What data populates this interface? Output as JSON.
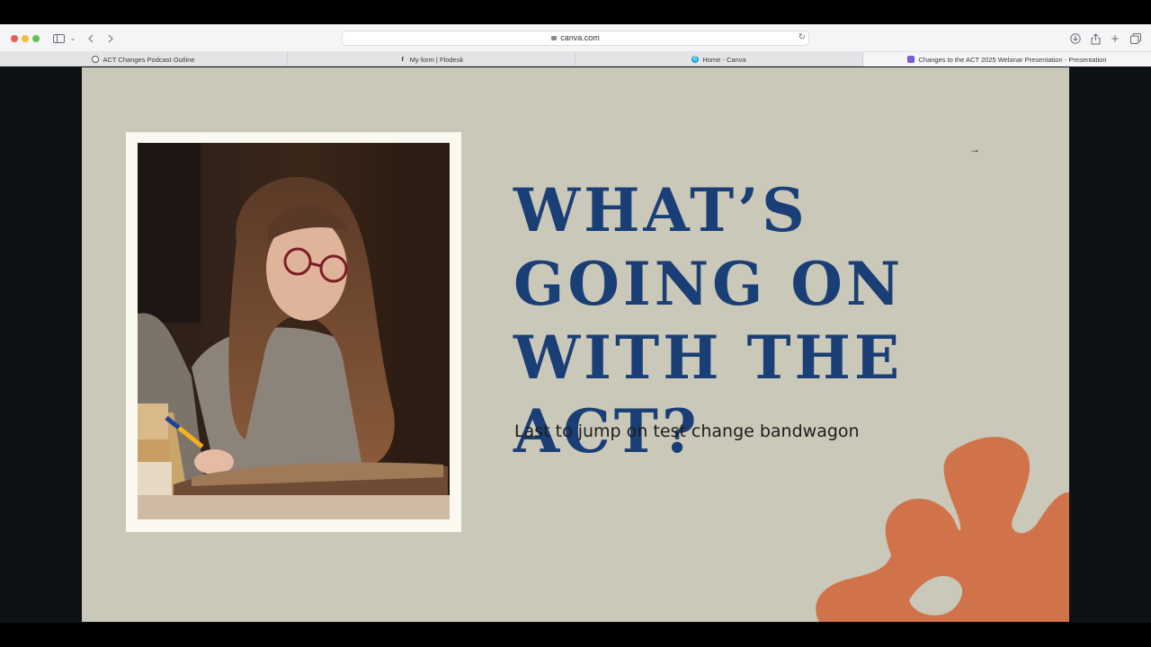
{
  "browser": {
    "address": "canva.com",
    "tabs": [
      {
        "label": "ACT Changes Podcast Outline",
        "favicon": "notion-icon"
      },
      {
        "label": "My form | Flodesk",
        "favicon": "flodesk-icon"
      },
      {
        "label": "Home - Canva",
        "favicon": "canva-icon"
      },
      {
        "label": "Changes to the ACT 2025 Webinar Presentation - Presentation",
        "favicon": "canva-presentation-icon"
      }
    ]
  },
  "slide": {
    "headline": "WHAT’S GOING ON WITH THE ACT?",
    "subline": "Last to jump on test change bandwagon",
    "colors": {
      "background": "#cac8b8",
      "headline": "#1a3e76",
      "accent": "#d0734a",
      "frame": "#fbf8ef"
    }
  }
}
